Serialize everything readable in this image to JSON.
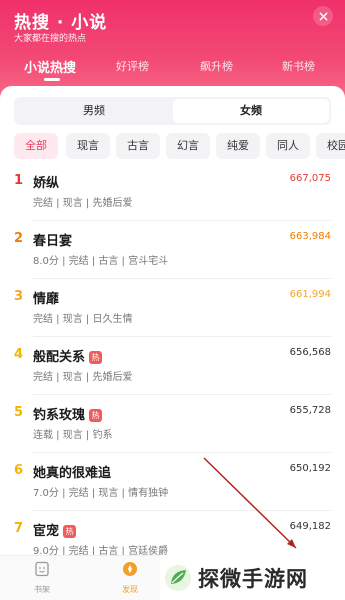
{
  "header": {
    "title": "热搜 · 小说",
    "subtitle": "大家都在搜的热点",
    "tabs": [
      {
        "label": "小说热搜",
        "active": true
      },
      {
        "label": "好评榜",
        "active": false
      },
      {
        "label": "飙升榜",
        "active": false
      },
      {
        "label": "新书榜",
        "active": false
      }
    ]
  },
  "gender_tabs": [
    {
      "label": "男频",
      "selected": false
    },
    {
      "label": "女频",
      "selected": true
    }
  ],
  "categories": [
    {
      "label": "全部",
      "active": true
    },
    {
      "label": "现言",
      "active": false
    },
    {
      "label": "古言",
      "active": false
    },
    {
      "label": "幻言",
      "active": false
    },
    {
      "label": "纯爱",
      "active": false
    },
    {
      "label": "同人",
      "active": false
    },
    {
      "label": "校园",
      "active": false
    }
  ],
  "rank_colors": {
    "1": "#e53935",
    "2": "#f57c00",
    "3": "#f5a623",
    "other": "#f5b400"
  },
  "count_colors": {
    "1": "#e53935",
    "2": "#f57c00",
    "3": "#f5a623",
    "other": "#333333"
  },
  "books": [
    {
      "rank": "1",
      "title": "娇纵",
      "hot": false,
      "meta": "完结 | 现言 | 先婚后爱",
      "count": "667,075"
    },
    {
      "rank": "2",
      "title": "春日宴",
      "hot": false,
      "meta": "8.0分 | 完结 | 古言 | 宫斗宅斗",
      "count": "663,984"
    },
    {
      "rank": "3",
      "title": "情靡",
      "hot": false,
      "meta": "完结 | 现言 | 日久生情",
      "count": "661,994"
    },
    {
      "rank": "4",
      "title": "般配关系",
      "hot": true,
      "meta": "完结 | 现言 | 先婚后爱",
      "count": "656,568"
    },
    {
      "rank": "5",
      "title": "钓系玫瑰",
      "hot": true,
      "meta": "连载 | 现言 | 钓系",
      "count": "655,728"
    },
    {
      "rank": "6",
      "title": "她真的很难追",
      "hot": false,
      "meta": "7.0分 | 完结 | 现言 | 情有独钟",
      "count": "650,192"
    },
    {
      "rank": "7",
      "title": "宦宠",
      "hot": true,
      "meta": "9.0分 | 完结 | 古言 | 宫廷侯爵",
      "count": "649,182"
    }
  ],
  "hot_badge": "热",
  "bottom_nav": [
    {
      "label": "书架",
      "icon": "bookshelf-icon",
      "active": false
    },
    {
      "label": "发现",
      "icon": "discover-icon",
      "active": true
    }
  ],
  "watermark": {
    "text": "探微手游网",
    "icon": "leaf-logo-icon"
  }
}
